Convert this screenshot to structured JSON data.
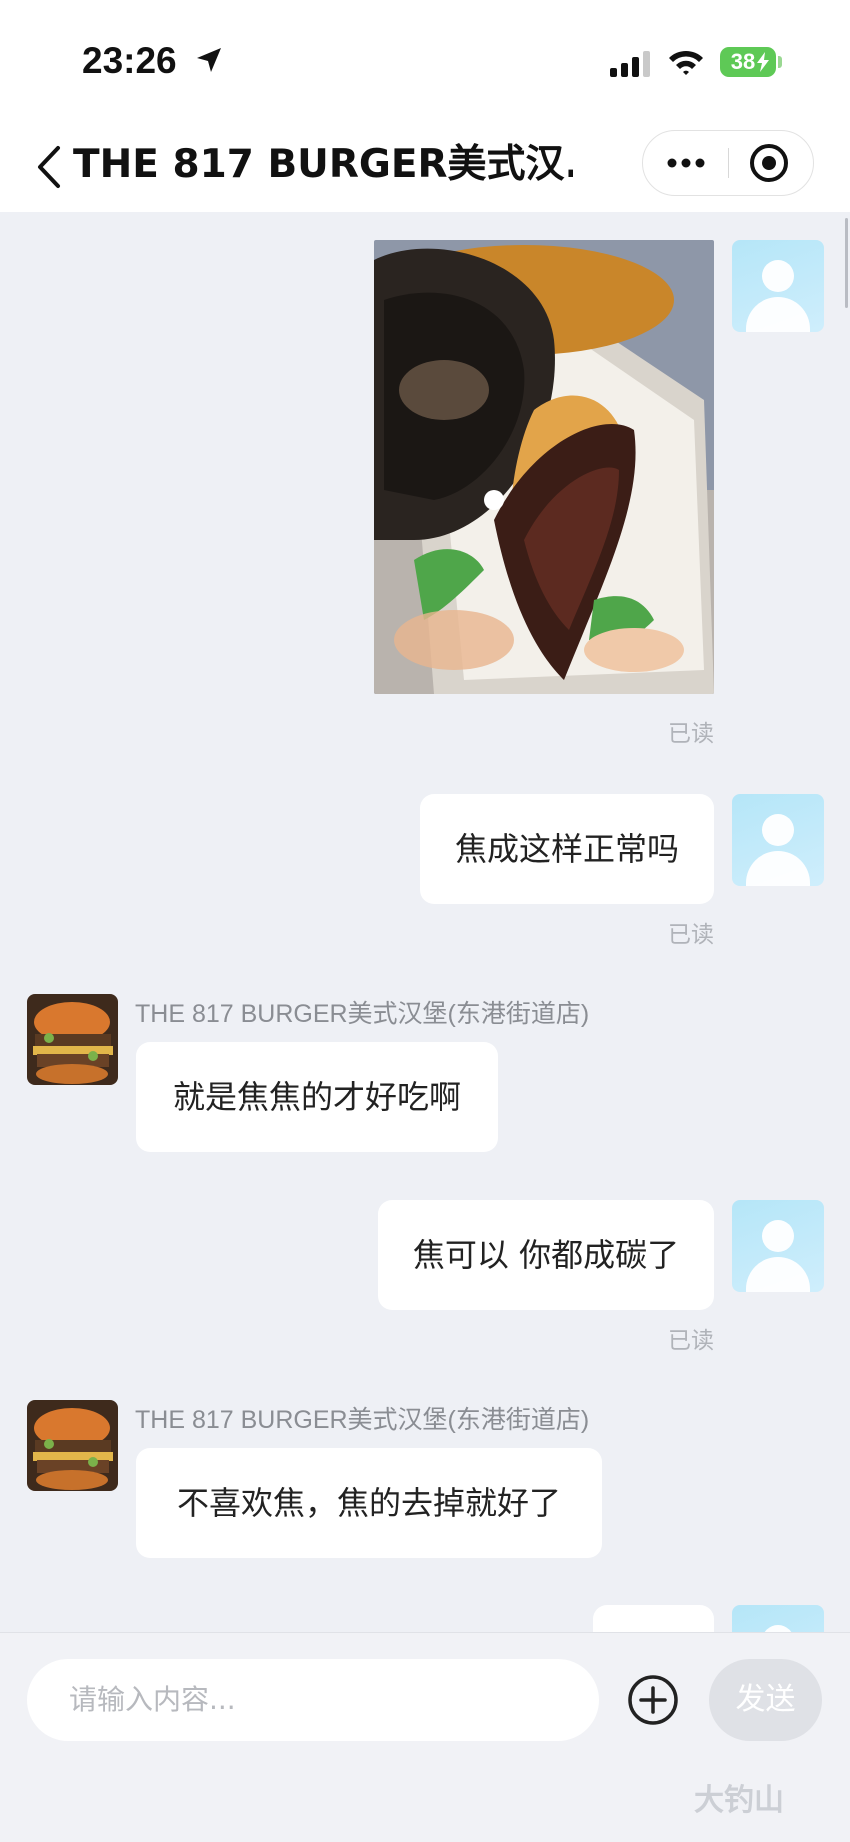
{
  "status_bar": {
    "time": "23:26",
    "battery": "38",
    "icons": [
      "location-arrow-icon",
      "cellular-signal-icon",
      "wifi-icon",
      "battery-charging-icon"
    ]
  },
  "nav": {
    "title": "THE 817 BURGER美式汉...",
    "icons": [
      "chevron-left-icon",
      "more-dots-icon",
      "target-close-icon"
    ]
  },
  "messages": [
    {
      "side": "right",
      "type": "image",
      "content": "burnt burger photo",
      "read": "已读"
    },
    {
      "side": "right",
      "type": "text",
      "text": "焦成这样正常吗",
      "read": "已读"
    },
    {
      "side": "left",
      "type": "text",
      "sender": "THE 817 BURGER美式汉堡(东港街道店)",
      "text": "就是焦焦的才好吃啊"
    },
    {
      "side": "right",
      "type": "text",
      "text": "焦可以 你都成碳了",
      "read": "已读"
    },
    {
      "side": "left",
      "type": "text",
      "sender": "THE 817 BURGER美式汉堡(东港街道店)",
      "text": "不喜欢焦，焦的去掉就好了"
    }
  ],
  "input": {
    "placeholder": "请输入内容...",
    "send_label": "发送"
  },
  "watermark": "大钓山",
  "colors": {
    "background": "#eef0f5",
    "bubble": "#ffffff",
    "read_text": "#b0b3b9",
    "battery": "#5ec956",
    "send_disabled": "#dfe1e6"
  }
}
